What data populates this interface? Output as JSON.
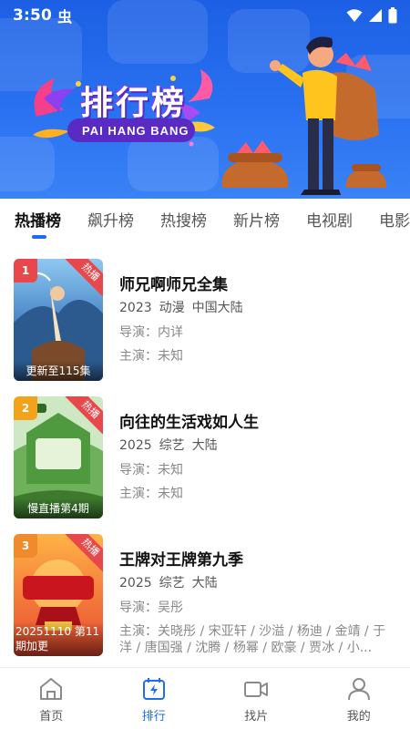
{
  "status_bar": {
    "time": "3:50",
    "extra_glyph": "虫"
  },
  "banner": {
    "title": "排行榜",
    "subtitle": "PAI HANG BANG"
  },
  "tabs": [
    {
      "label": "热播榜",
      "active": true
    },
    {
      "label": "飙升榜",
      "active": false
    },
    {
      "label": "热搜榜",
      "active": false
    },
    {
      "label": "新片榜",
      "active": false
    },
    {
      "label": "电视剧",
      "active": false
    },
    {
      "label": "电影",
      "active": false
    }
  ],
  "items": [
    {
      "rank": "1",
      "hot_tag": "热播",
      "caption": "更新至115集",
      "title": "师兄啊师兄全集",
      "year": "2023",
      "genre": "动漫",
      "region": "中国大陆",
      "director": "导演：内详",
      "cast": "主演：未知",
      "badge_color": "#e8484b"
    },
    {
      "rank": "2",
      "hot_tag": "热播",
      "caption": "慢直播第4期",
      "title": "向往的生活戏如人生",
      "year": "2025",
      "genre": "综艺",
      "region": "大陆",
      "director": "导演：未知",
      "cast": "主演：未知",
      "badge_color": "#f3a21b"
    },
    {
      "rank": "3",
      "hot_tag": "热播",
      "caption": "20251110 第11期加更",
      "title": "王牌对王牌第九季",
      "year": "2025",
      "genre": "综艺",
      "region": "大陆",
      "director": "导演：吴彤",
      "cast": "主演：关晓彤 / 宋亚轩 / 沙溢 / 杨迪 / 金靖 / 于洋 / 唐国强 / 沈腾 / 杨幂 / 欧豪 / 贾冰 / 小...",
      "badge_color": "#f08a2a"
    }
  ],
  "bottom_nav": [
    {
      "label": "首页",
      "icon": "home-icon",
      "active": false
    },
    {
      "label": "排行",
      "icon": "ranking-icon",
      "active": true
    },
    {
      "label": "找片",
      "icon": "video-camera-icon",
      "active": false
    },
    {
      "label": "我的",
      "icon": "user-icon",
      "active": false
    }
  ],
  "colors": {
    "accent": "#1f6bf2",
    "banner_blue": "#2b73f2",
    "hot_red": "#e8484b"
  }
}
